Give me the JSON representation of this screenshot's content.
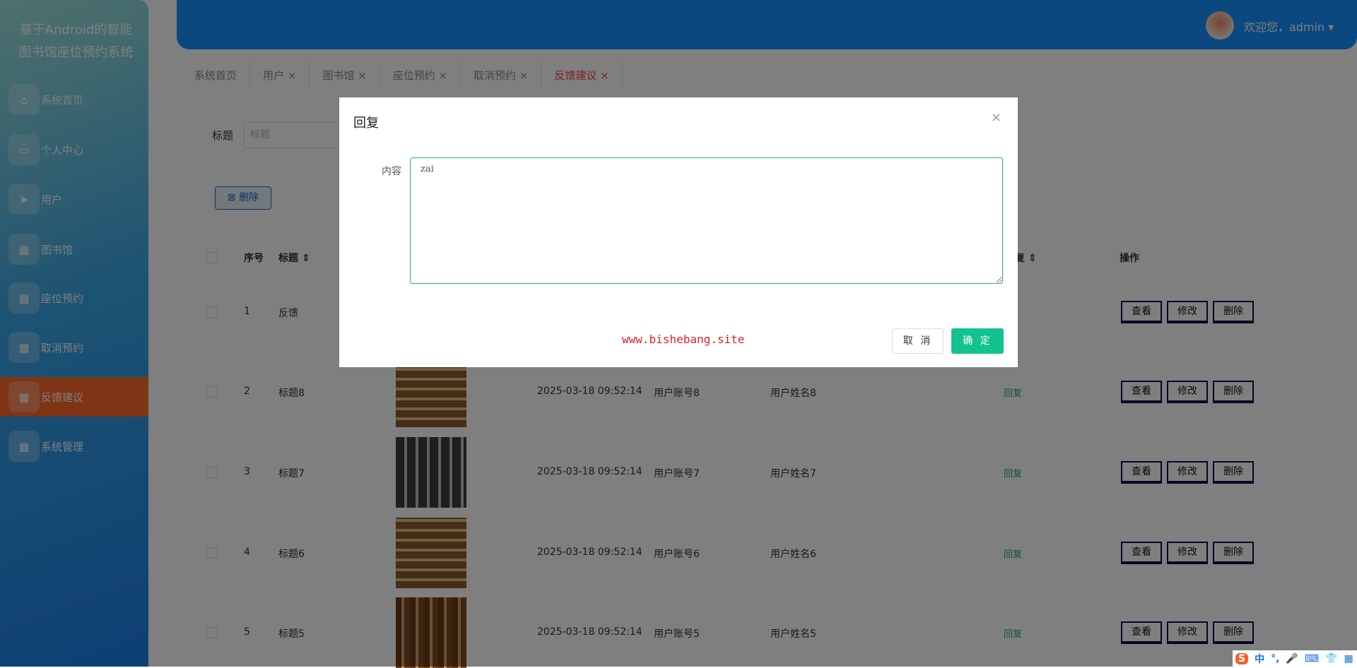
{
  "app": {
    "title_line1": "基于Android的智能",
    "title_line2": "图书馆座位预约系统"
  },
  "sidebar": {
    "items": [
      {
        "label": "系统首页",
        "icon": "home-icon"
      },
      {
        "label": "个人中心",
        "icon": "profile-icon"
      },
      {
        "label": "用户",
        "icon": "send-icon"
      },
      {
        "label": "图书馆",
        "icon": "grid-icon"
      },
      {
        "label": "座位预约",
        "icon": "grid-icon"
      },
      {
        "label": "取消预约",
        "icon": "grid-icon"
      },
      {
        "label": "反馈建议",
        "icon": "grid-icon",
        "active": true
      },
      {
        "label": "系统管理",
        "icon": "grid-icon"
      }
    ]
  },
  "header": {
    "welcome": "欢迎您，admin ▾"
  },
  "tabs": [
    {
      "label": "系统首页"
    },
    {
      "label": "用户 ×"
    },
    {
      "label": "图书馆 ×"
    },
    {
      "label": "座位预约 ×"
    },
    {
      "label": "取消预约 ×"
    },
    {
      "label": "反馈建议 ×",
      "active": true
    }
  ],
  "search": {
    "label": "标题",
    "placeholder": "标题"
  },
  "toolbar": {
    "delete_label": "⊠ 删除"
  },
  "table": {
    "headers": {
      "index": "序号",
      "title": "标题 ⇕",
      "reply": "复 ⇕",
      "actions": "操作"
    },
    "rows": [
      {
        "index": "1",
        "title": "反馈",
        "time": "",
        "account": "",
        "name": "",
        "reply": ""
      },
      {
        "index": "2",
        "title": "标题8",
        "time": "2025-03-18 09:52:14",
        "account": "用户账号8",
        "name": "用户姓名8",
        "reply": "回复"
      },
      {
        "index": "3",
        "title": "标题7",
        "time": "2025-03-18 09:52:14",
        "account": "用户账号7",
        "name": "用户姓名7",
        "reply": "回复"
      },
      {
        "index": "4",
        "title": "标题6",
        "time": "2025-03-18 09:52:14",
        "account": "用户账号6",
        "name": "用户姓名6",
        "reply": "回复"
      },
      {
        "index": "5",
        "title": "标题5",
        "time": "2025-03-18 09:52:14",
        "account": "用户账号5",
        "name": "用户姓名5",
        "reply": "回复"
      }
    ],
    "actions": {
      "view": "查看",
      "edit": "修改",
      "delete": "删除"
    }
  },
  "dialog": {
    "title": "回复",
    "close": "×",
    "content_label": "内容",
    "content_value": "zai",
    "watermark": "www.bishebang.site",
    "cancel": "取 消",
    "ok": "确 定"
  },
  "ime": {
    "logo": "S",
    "mode": "中",
    "punct": "°,",
    "mic": "🎤",
    "keyboard": "⌨",
    "skin": "👕",
    "apps": "▦"
  },
  "colors": {
    "primary": "#1690ff",
    "active_menu": "#ff6a2a",
    "confirm": "#13c28f",
    "watermark": "#e0202a"
  }
}
